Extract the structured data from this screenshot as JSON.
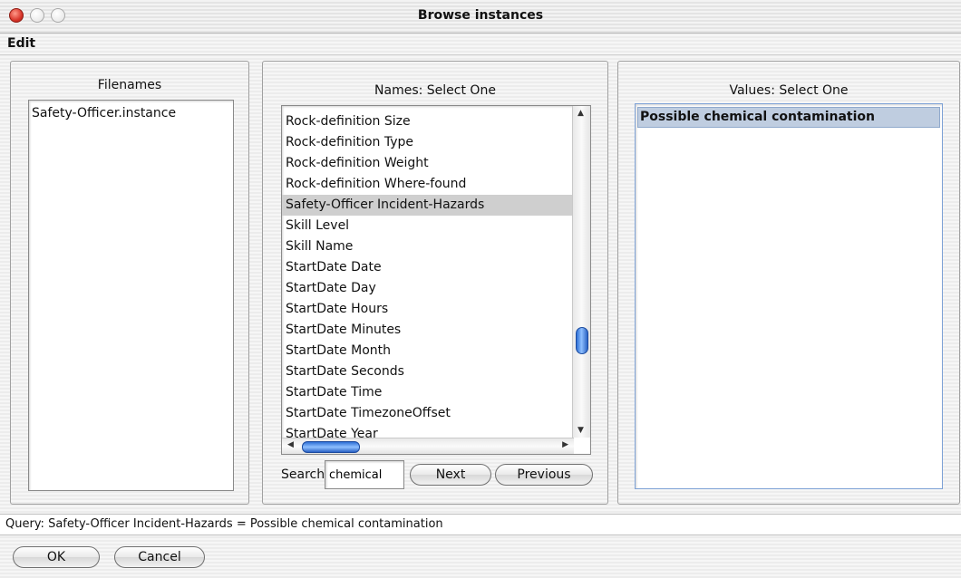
{
  "window": {
    "title": "Browse instances"
  },
  "menu": {
    "edit": "Edit"
  },
  "filenames": {
    "title": "Filenames",
    "items": [
      "Safety-Officer.instance"
    ]
  },
  "names": {
    "title": "Names: Select One",
    "items": [
      "Rock-definition Size",
      "Rock-definition Type",
      "Rock-definition Weight",
      "Rock-definition Where-found",
      "Safety-Officer Incident-Hazards",
      "Skill Level",
      "Skill Name",
      "StartDate Date",
      "StartDate Day",
      "StartDate Hours",
      "StartDate Minutes",
      "StartDate Month",
      "StartDate Seconds",
      "StartDate Time",
      "StartDate TimezoneOffset",
      "StartDate Year"
    ],
    "selected": "Safety-Officer Incident-Hazards"
  },
  "values": {
    "title": "Values: Select One",
    "items": [
      "Possible chemical contamination"
    ],
    "selected": "Possible chemical contamination"
  },
  "search": {
    "label": "Search",
    "value": "chemical",
    "next_label": "Next",
    "previous_label": "Previous"
  },
  "query": {
    "text": "Query: Safety-Officer Incident-Hazards = Possible chemical contamination"
  },
  "buttons": {
    "ok": "OK",
    "cancel": "Cancel"
  },
  "colors": {
    "selection_gray": "#cfcfcf",
    "selection_blue": "#bfcde0",
    "scroll_thumb": "#3b7be0"
  }
}
